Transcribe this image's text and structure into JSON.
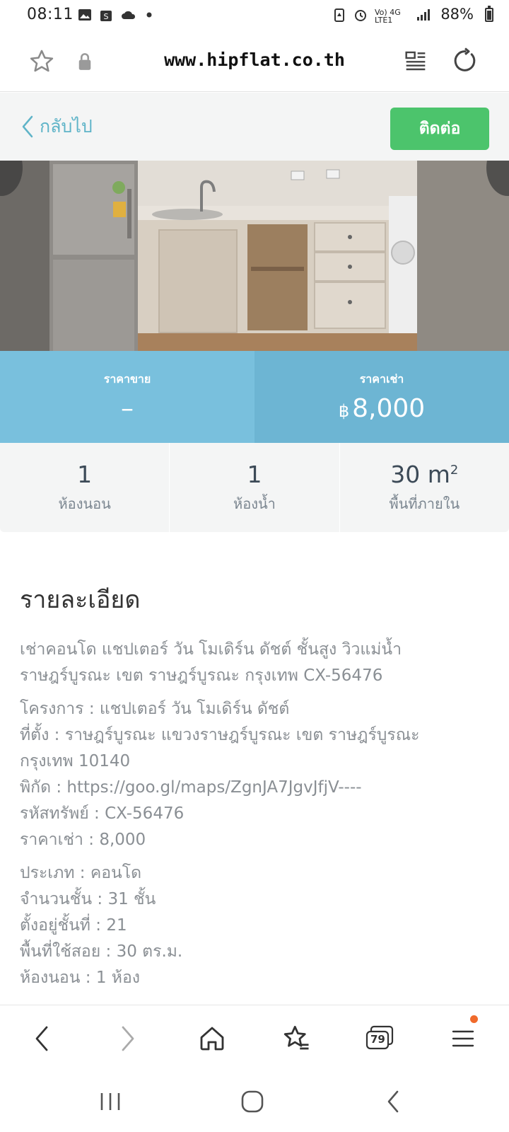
{
  "status_bar": {
    "time": "08:11",
    "network_text": "Vo) 4G LTE1",
    "battery": "88%"
  },
  "browser": {
    "url": "www.hipflat.co.th"
  },
  "header": {
    "back_label": "กลับไป",
    "contact_label": "ติดต่อ"
  },
  "price": {
    "sale_label": "ราคาขาย",
    "sale_value": "–",
    "rent_label": "ราคาเช่า",
    "currency": "฿",
    "rent_value": "8,000"
  },
  "stats": {
    "bedrooms_value": "1",
    "bedrooms_label": "ห้องนอน",
    "bathrooms_value": "1",
    "bathrooms_label": "ห้องน้ำ",
    "area_value": "30 m",
    "area_sup": "2",
    "area_label": "พื้นที่ภายใน"
  },
  "details": {
    "title": "รายละเอียด",
    "summary_1": "เช่าคอนโด แชปเตอร์ วัน โมเดิร์น ดัชต์ ชั้นสูง วิวแม่น้ำ",
    "summary_2": "ราษฎร์บูรณะ เขต ราษฎร์บูรณะ กรุงเทพ CX-56476",
    "project": "โครงการ : แชปเตอร์ วัน โมเดิร์น ดัชต์",
    "location_1": "ที่ตั้ง : ราษฎร์บูรณะ แขวงราษฎร์บูรณะ เขต ราษฎร์บูรณะ",
    "location_2": "กรุงเทพ 10140",
    "coords": "พิกัด : https://goo.gl/maps/ZgnJA7JgvJfjV----",
    "asset_code": "รหัสทรัพย์ : CX-56476",
    "rent_price": "ราคาเช่า : 8,000",
    "type": "ประเภท : คอนโด",
    "floors": "จำนวนชั้น : 31 ชั้น",
    "floor_no": "ตั้งอยู่ชั้นที่ : 21",
    "usable_area": "พื้นที่ใช้สอย : 30 ตร.ม.",
    "bedrooms": "ห้องนอน : 1 ห้อง"
  },
  "bottom_nav": {
    "tabs_count": "79"
  },
  "colors": {
    "accent_blue": "#5fb4c8",
    "contact_green": "#4cc46c",
    "price_sale_bg": "#79c0dd",
    "price_rent_bg": "#6db5d3",
    "notification": "#f06a2b"
  }
}
